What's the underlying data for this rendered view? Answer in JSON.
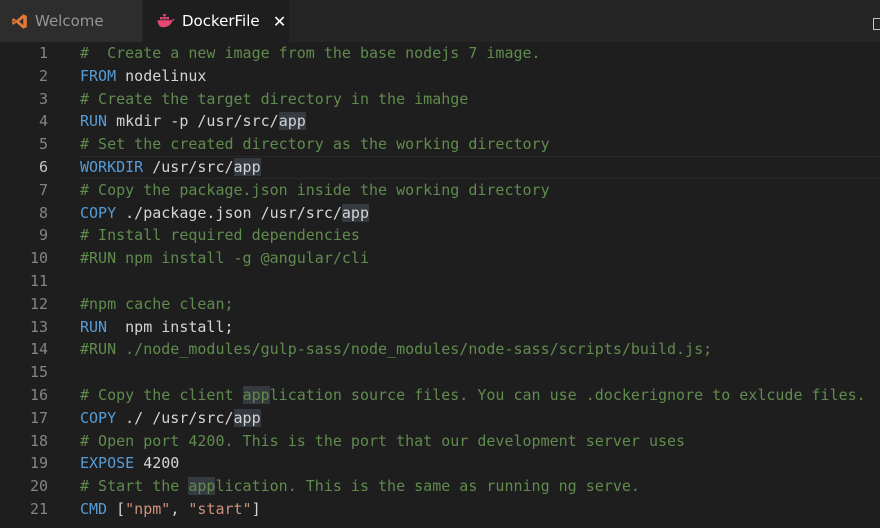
{
  "tabs": [
    {
      "label": "Welcome",
      "icon": "vscode-icon",
      "active": false
    },
    {
      "label": "DockerFile",
      "icon": "docker-icon",
      "active": true,
      "close": "✕"
    }
  ],
  "colors": {
    "keyword": "#569cd6",
    "comment": "#608b4e",
    "string": "#ce9178",
    "text": "#d4d4d4",
    "line_number": "#858585",
    "background": "#1e1e1e"
  },
  "lines": [
    {
      "n": "1",
      "tokens": [
        {
          "t": "#  Create a new image from the base nodejs 7 image.",
          "c": "cm"
        }
      ]
    },
    {
      "n": "2",
      "tokens": [
        {
          "t": "FROM",
          "c": "kw"
        },
        {
          "t": " nodelinux",
          "c": ""
        }
      ]
    },
    {
      "n": "3",
      "tokens": [
        {
          "t": "# Create the target directory in the imahge",
          "c": "cm"
        }
      ]
    },
    {
      "n": "4",
      "tokens": [
        {
          "t": "RUN",
          "c": "kw"
        },
        {
          "t": " mkdir -p /usr/src/",
          "c": ""
        },
        {
          "t": "app",
          "c": "hl"
        }
      ]
    },
    {
      "n": "5",
      "tokens": [
        {
          "t": "# Set the created directory as the working directory",
          "c": "cm"
        }
      ]
    },
    {
      "n": "6",
      "current": true,
      "tokens": [
        {
          "t": "WORKDIR",
          "c": "kw"
        },
        {
          "t": " /usr/src/",
          "c": ""
        },
        {
          "t": "app",
          "c": "hl"
        }
      ]
    },
    {
      "n": "7",
      "tokens": [
        {
          "t": "# Copy the package.json inside the working directory",
          "c": "cm"
        }
      ]
    },
    {
      "n": "8",
      "tokens": [
        {
          "t": "COPY",
          "c": "kw"
        },
        {
          "t": " ./package.json /usr/src/",
          "c": ""
        },
        {
          "t": "app",
          "c": "hl"
        }
      ]
    },
    {
      "n": "9",
      "tokens": [
        {
          "t": "# Install required dependencies",
          "c": "cm"
        }
      ]
    },
    {
      "n": "10",
      "tokens": [
        {
          "t": "#RUN npm install -g @angular/cli",
          "c": "cm"
        }
      ]
    },
    {
      "n": "11",
      "tokens": []
    },
    {
      "n": "12",
      "tokens": [
        {
          "t": "#npm cache clean;",
          "c": "cm"
        }
      ]
    },
    {
      "n": "13",
      "tokens": [
        {
          "t": "RUN",
          "c": "kw"
        },
        {
          "t": "  npm install;",
          "c": ""
        }
      ]
    },
    {
      "n": "14",
      "tokens": [
        {
          "t": "#RUN ./node_modules/gulp-sass/node_modules/node-sass/scripts/build.js;",
          "c": "cm"
        }
      ]
    },
    {
      "n": "15",
      "tokens": []
    },
    {
      "n": "16",
      "tokens": [
        {
          "t": "# Copy the client ",
          "c": "cm"
        },
        {
          "t": "app",
          "c": "cm hl"
        },
        {
          "t": "lication source files. You can use .dockerignore to exlcude files.",
          "c": "cm"
        }
      ]
    },
    {
      "n": "17",
      "tokens": [
        {
          "t": "COPY",
          "c": "kw"
        },
        {
          "t": " ./ /usr/src/",
          "c": ""
        },
        {
          "t": "app",
          "c": "hl"
        }
      ]
    },
    {
      "n": "18",
      "tokens": [
        {
          "t": "# Open port 4200. This is the port that our development server uses",
          "c": "cm"
        }
      ]
    },
    {
      "n": "19",
      "tokens": [
        {
          "t": "EXPOSE",
          "c": "kw"
        },
        {
          "t": " 4200",
          "c": ""
        }
      ]
    },
    {
      "n": "20",
      "tokens": [
        {
          "t": "# Start the ",
          "c": "cm"
        },
        {
          "t": "app",
          "c": "cm hl"
        },
        {
          "t": "lication. This is the same as running ng serve.",
          "c": "cm"
        }
      ]
    },
    {
      "n": "21",
      "tokens": [
        {
          "t": "CMD",
          "c": "kw"
        },
        {
          "t": " [",
          "c": ""
        },
        {
          "t": "\"npm\"",
          "c": "str"
        },
        {
          "t": ", ",
          "c": ""
        },
        {
          "t": "\"start\"",
          "c": "str"
        },
        {
          "t": "]",
          "c": ""
        }
      ]
    }
  ]
}
